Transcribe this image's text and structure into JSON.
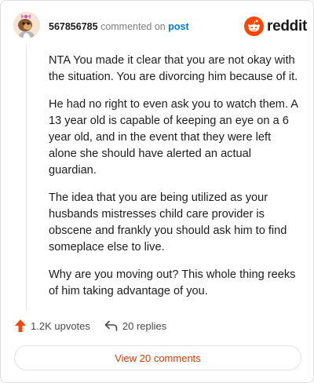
{
  "comment": {
    "username": "567856785",
    "commented_text": "commented on",
    "post_link": "post",
    "paragraphs": [
      "NTA You made it clear that you are not okay with the situation. You are divorcing him because of it.",
      "He had no right to even ask you to watch them. A 13 year old is capable of keeping an eye on a 6 year old, and in the event that they were left alone she should have alerted an actual guardian.",
      "The idea that you are being utilized as your husbands mistresses child care provider is obscene and frankly you should ask him to find someplace else to live.",
      "Why are you moving out? This whole thing reeks of him taking advantage of you."
    ]
  },
  "brand": {
    "wordmark": "reddit",
    "icon": "reddit-snoo-icon",
    "color": "#ff4500"
  },
  "actions": {
    "upvotes": "1.2K upvotes",
    "replies": "20 replies",
    "upvote_icon": "upvote-arrow-icon",
    "reply_icon": "reply-arrow-icon",
    "upvote_color": "#ff4500"
  },
  "footer": {
    "view_label": "View 20 comments"
  }
}
